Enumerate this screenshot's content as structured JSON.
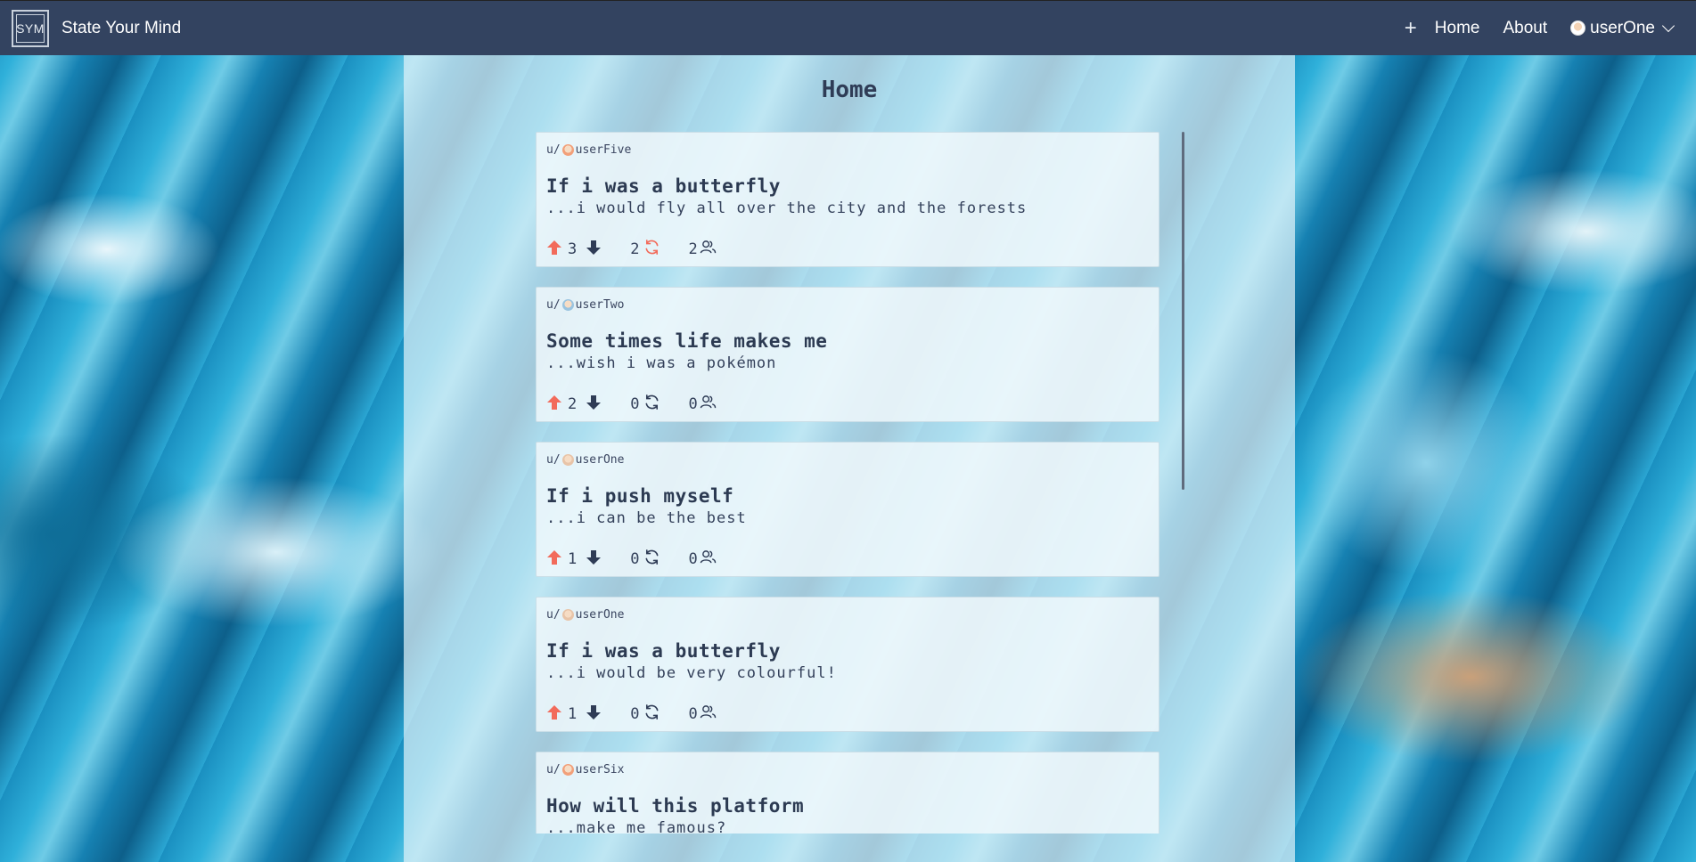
{
  "navbar": {
    "logo_text": "SYM",
    "brand": "State Your Mind",
    "links": [
      "Home",
      "About"
    ],
    "user": "userOne"
  },
  "page": {
    "title": "Home"
  },
  "colors": {
    "upvote": "#f26b5b",
    "repost_active": "#f26b5b",
    "text": "#2f3c56",
    "nav_bg": "#334360"
  },
  "posts": [
    {
      "prefix": "u/",
      "author": "userFive",
      "avatar_color": "#f2a07a",
      "title": "If i was a butterfly",
      "body": "...i would fly all over the city and the forests",
      "upvotes": "3",
      "reposts": "2",
      "reposted": true,
      "members": "2"
    },
    {
      "prefix": "u/",
      "author": "userTwo",
      "avatar_color": "#9ac4e0",
      "title": "Some times life makes me",
      "body": "...wish i was a pokémon",
      "upvotes": "2",
      "reposts": "0",
      "reposted": false,
      "members": "0"
    },
    {
      "prefix": "u/",
      "author": "userOne",
      "avatar_color": "#e8c4a8",
      "title": "If i push myself",
      "body": "...i can be the best",
      "upvotes": "1",
      "reposts": "0",
      "reposted": false,
      "members": "0"
    },
    {
      "prefix": "u/",
      "author": "userOne",
      "avatar_color": "#e8c4a8",
      "title": "If i was a butterfly",
      "body": "...i would be very colourful!",
      "upvotes": "1",
      "reposts": "0",
      "reposted": false,
      "members": "0"
    },
    {
      "prefix": "u/",
      "author": "userSix",
      "avatar_color": "#f2a07a",
      "title": "How will this platform",
      "body": "...make me famous?",
      "upvotes": "",
      "reposts": "",
      "reposted": false,
      "members": ""
    }
  ]
}
